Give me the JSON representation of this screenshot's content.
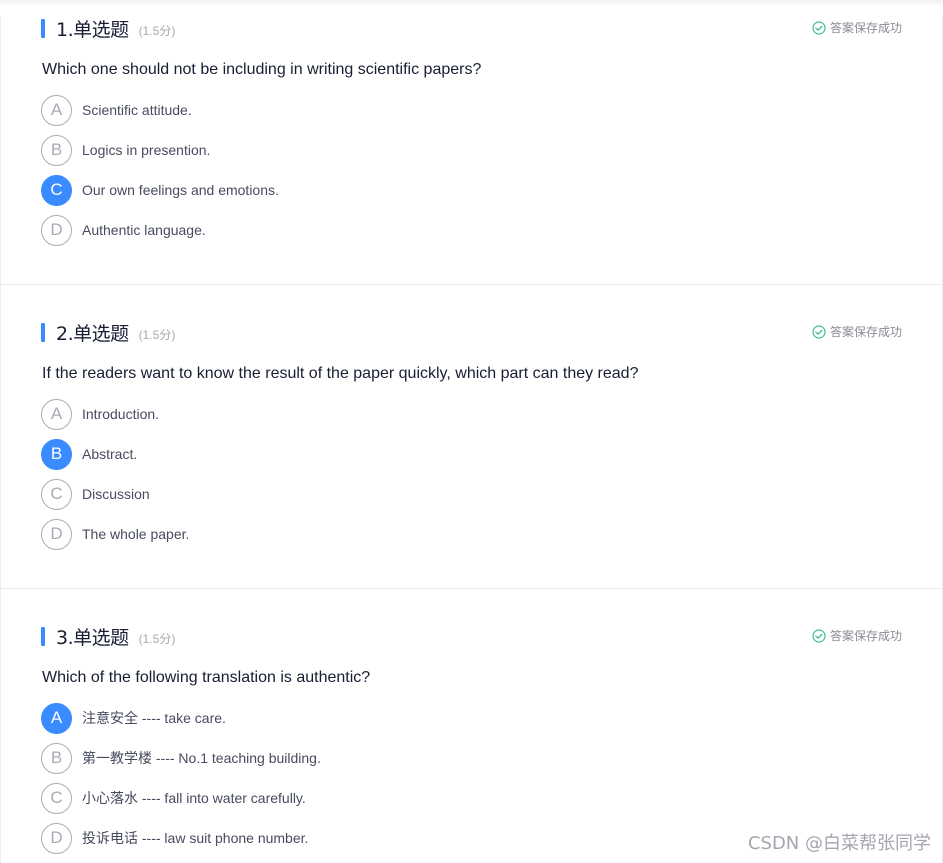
{
  "questions": [
    {
      "title": "1.单选题",
      "score": "(1.5分)",
      "status": "答案保存成功",
      "stem": "Which one should not be including in writing scientific papers?",
      "options": [
        {
          "letter": "A",
          "text": "Scientific attitude.",
          "selected": false
        },
        {
          "letter": "B",
          "text": "Logics in presention.",
          "selected": false
        },
        {
          "letter": "C",
          "text": "Our own feelings and emotions.",
          "selected": true
        },
        {
          "letter": "D",
          "text": "Authentic language.",
          "selected": false
        }
      ]
    },
    {
      "title": "2.单选题",
      "score": "(1.5分)",
      "status": "答案保存成功",
      "stem": "If the readers want to know the result of the paper quickly, which part can they read?",
      "options": [
        {
          "letter": "A",
          "text": "Introduction.",
          "selected": false
        },
        {
          "letter": "B",
          "text": "Abstract.",
          "selected": true
        },
        {
          "letter": "C",
          "text": "Discussion",
          "selected": false
        },
        {
          "letter": "D",
          "text": "The whole paper.",
          "selected": false
        }
      ]
    },
    {
      "title": "3.单选题",
      "score": "(1.5分)",
      "status": "答案保存成功",
      "stem": "Which of the following translation is authentic?",
      "options": [
        {
          "letter": "A",
          "text": "注意安全 ---- take care.",
          "selected": true
        },
        {
          "letter": "B",
          "text": "第一教学楼 ---- No.1 teaching building.",
          "selected": false
        },
        {
          "letter": "C",
          "text": "小心落水 ---- fall into water carefully.",
          "selected": false
        },
        {
          "letter": "D",
          "text": "投诉电话 ---- law suit phone number.",
          "selected": false
        }
      ]
    }
  ],
  "watermark": "CSDN @白菜帮张同学",
  "colors": {
    "accent": "#3a8bff",
    "success": "#3bbf87",
    "text": "#181e33",
    "muted": "#8a8b99"
  },
  "icons": {
    "status": "check-circle-icon"
  }
}
